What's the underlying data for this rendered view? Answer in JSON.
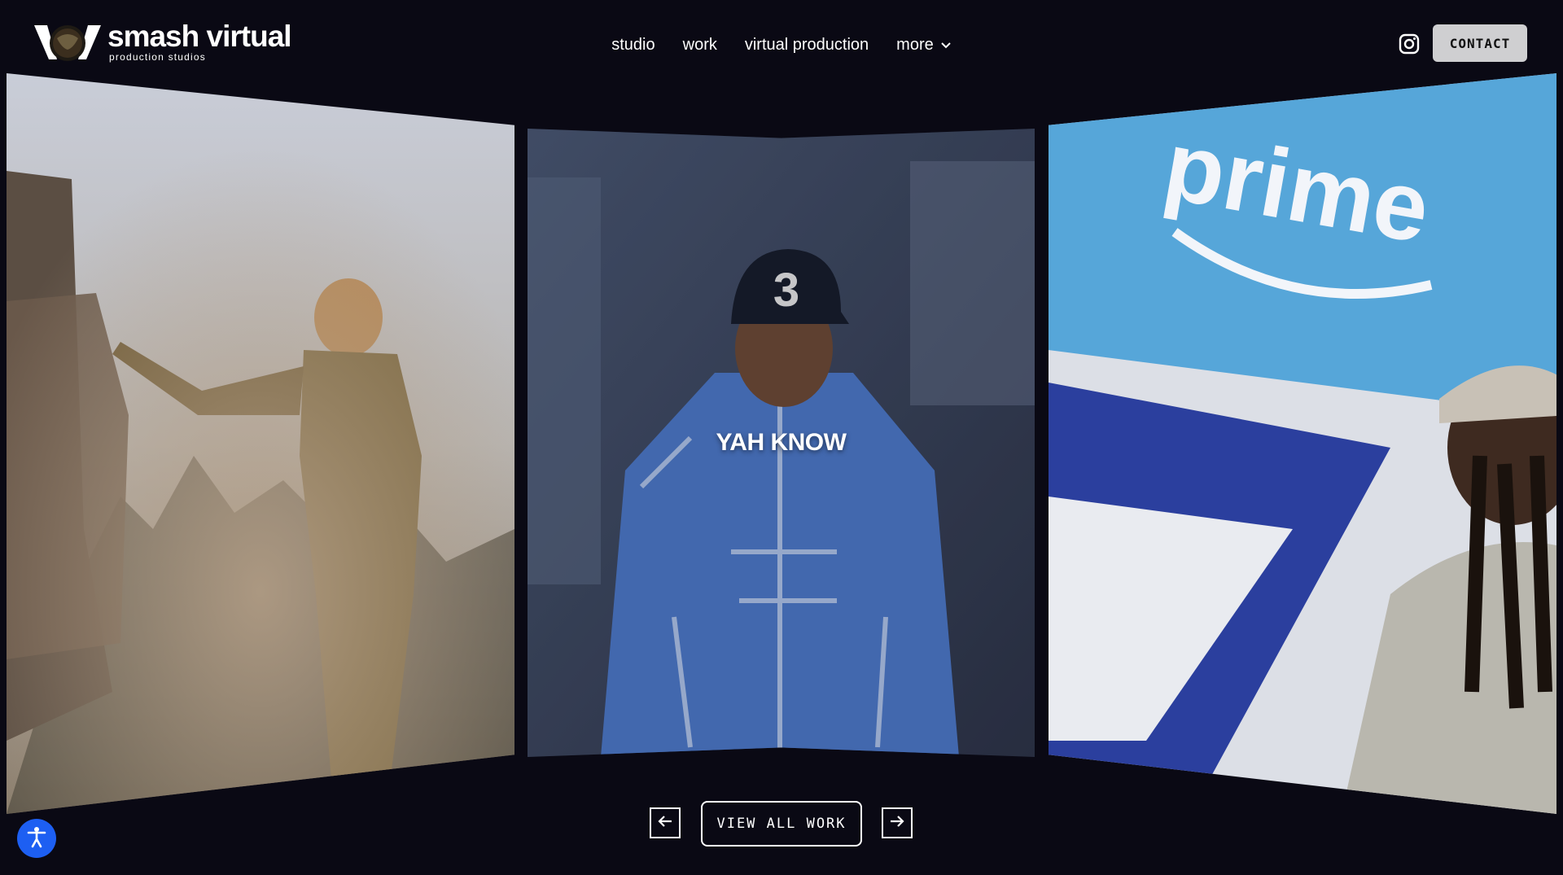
{
  "brand": {
    "name": "smash virtual",
    "tagline": "production studios",
    "accent": "#0a0914"
  },
  "nav": {
    "items": [
      {
        "label": "studio"
      },
      {
        "label": "work"
      },
      {
        "label": "virtual production"
      },
      {
        "label": "more"
      }
    ],
    "contact_label": "CONTACT"
  },
  "slides": {
    "left": {
      "title": ""
    },
    "center": {
      "title": "YAH KNOW"
    },
    "right": {
      "title": ""
    }
  },
  "controls": {
    "view_all_label": "VIEW ALL WORK"
  },
  "icons": {
    "logo": "smash-virtual-logo-icon",
    "instagram": "instagram-icon",
    "chevron": "chevron-down-icon",
    "prev": "arrow-left-icon",
    "next": "arrow-right-icon",
    "accessibility": "accessibility-icon"
  },
  "colors": {
    "background": "#0a0914",
    "contact_button": "#cfcfd1",
    "accessibility_button": "#1d5ff2"
  }
}
